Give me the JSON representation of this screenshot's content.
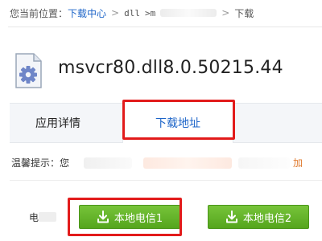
{
  "breadcrumb": {
    "prefix": "您当前位置：",
    "download_center": "下载中心",
    "sep1": ">",
    "dll": "dll",
    "sep2": ">m",
    "sep3": ">",
    "last": "下载"
  },
  "title": "msvcr80.dll8.0.50215.44",
  "tabs": [
    {
      "label": "应用详情",
      "active": false
    },
    {
      "label": "下载地址",
      "active": true
    }
  ],
  "tip": {
    "label": "温馨提示：",
    "first_char": "您",
    "tail": "加"
  },
  "download_row": {
    "label": "电"
  },
  "buttons": [
    {
      "label": "本地电信1"
    },
    {
      "label": "本地电信2"
    }
  ],
  "colors": {
    "link": "#1c64c8",
    "button_green": "#5bab22",
    "highlight_red": "#e21b1b"
  },
  "icons": {
    "file": "dll-file-gear-icon",
    "download": "download-arrow-icon"
  }
}
